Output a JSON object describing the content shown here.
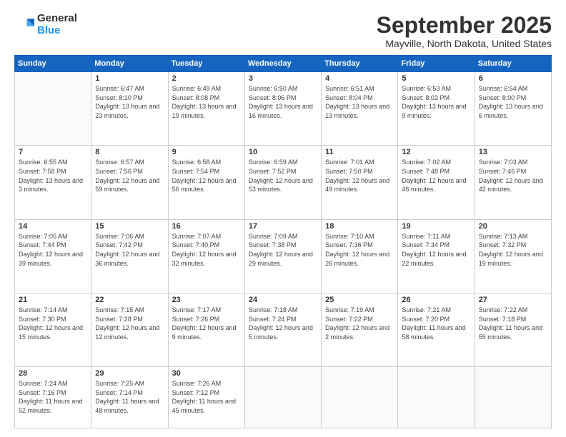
{
  "header": {
    "logo": {
      "general": "General",
      "blue": "Blue"
    },
    "title": "September 2025",
    "location": "Mayville, North Dakota, United States"
  },
  "weekdays": [
    "Sunday",
    "Monday",
    "Tuesday",
    "Wednesday",
    "Thursday",
    "Friday",
    "Saturday"
  ],
  "weeks": [
    [
      {
        "day": "",
        "sunrise": "",
        "sunset": "",
        "daylight": ""
      },
      {
        "day": "1",
        "sunrise": "Sunrise: 6:47 AM",
        "sunset": "Sunset: 8:10 PM",
        "daylight": "Daylight: 13 hours and 23 minutes."
      },
      {
        "day": "2",
        "sunrise": "Sunrise: 6:49 AM",
        "sunset": "Sunset: 8:08 PM",
        "daylight": "Daylight: 13 hours and 19 minutes."
      },
      {
        "day": "3",
        "sunrise": "Sunrise: 6:50 AM",
        "sunset": "Sunset: 8:06 PM",
        "daylight": "Daylight: 13 hours and 16 minutes."
      },
      {
        "day": "4",
        "sunrise": "Sunrise: 6:51 AM",
        "sunset": "Sunset: 8:04 PM",
        "daylight": "Daylight: 13 hours and 13 minutes."
      },
      {
        "day": "5",
        "sunrise": "Sunrise: 6:53 AM",
        "sunset": "Sunset: 8:02 PM",
        "daylight": "Daylight: 13 hours and 9 minutes."
      },
      {
        "day": "6",
        "sunrise": "Sunrise: 6:54 AM",
        "sunset": "Sunset: 8:00 PM",
        "daylight": "Daylight: 13 hours and 6 minutes."
      }
    ],
    [
      {
        "day": "7",
        "sunrise": "Sunrise: 6:55 AM",
        "sunset": "Sunset: 7:58 PM",
        "daylight": "Daylight: 13 hours and 3 minutes."
      },
      {
        "day": "8",
        "sunrise": "Sunrise: 6:57 AM",
        "sunset": "Sunset: 7:56 PM",
        "daylight": "Daylight: 12 hours and 59 minutes."
      },
      {
        "day": "9",
        "sunrise": "Sunrise: 6:58 AM",
        "sunset": "Sunset: 7:54 PM",
        "daylight": "Daylight: 12 hours and 56 minutes."
      },
      {
        "day": "10",
        "sunrise": "Sunrise: 6:59 AM",
        "sunset": "Sunset: 7:52 PM",
        "daylight": "Daylight: 12 hours and 53 minutes."
      },
      {
        "day": "11",
        "sunrise": "Sunrise: 7:01 AM",
        "sunset": "Sunset: 7:50 PM",
        "daylight": "Daylight: 12 hours and 49 minutes."
      },
      {
        "day": "12",
        "sunrise": "Sunrise: 7:02 AM",
        "sunset": "Sunset: 7:48 PM",
        "daylight": "Daylight: 12 hours and 46 minutes."
      },
      {
        "day": "13",
        "sunrise": "Sunrise: 7:03 AM",
        "sunset": "Sunset: 7:46 PM",
        "daylight": "Daylight: 12 hours and 42 minutes."
      }
    ],
    [
      {
        "day": "14",
        "sunrise": "Sunrise: 7:05 AM",
        "sunset": "Sunset: 7:44 PM",
        "daylight": "Daylight: 12 hours and 39 minutes."
      },
      {
        "day": "15",
        "sunrise": "Sunrise: 7:06 AM",
        "sunset": "Sunset: 7:42 PM",
        "daylight": "Daylight: 12 hours and 36 minutes."
      },
      {
        "day": "16",
        "sunrise": "Sunrise: 7:07 AM",
        "sunset": "Sunset: 7:40 PM",
        "daylight": "Daylight: 12 hours and 32 minutes."
      },
      {
        "day": "17",
        "sunrise": "Sunrise: 7:09 AM",
        "sunset": "Sunset: 7:38 PM",
        "daylight": "Daylight: 12 hours and 29 minutes."
      },
      {
        "day": "18",
        "sunrise": "Sunrise: 7:10 AM",
        "sunset": "Sunset: 7:36 PM",
        "daylight": "Daylight: 12 hours and 26 minutes."
      },
      {
        "day": "19",
        "sunrise": "Sunrise: 7:11 AM",
        "sunset": "Sunset: 7:34 PM",
        "daylight": "Daylight: 12 hours and 22 minutes."
      },
      {
        "day": "20",
        "sunrise": "Sunrise: 7:13 AM",
        "sunset": "Sunset: 7:32 PM",
        "daylight": "Daylight: 12 hours and 19 minutes."
      }
    ],
    [
      {
        "day": "21",
        "sunrise": "Sunrise: 7:14 AM",
        "sunset": "Sunset: 7:30 PM",
        "daylight": "Daylight: 12 hours and 15 minutes."
      },
      {
        "day": "22",
        "sunrise": "Sunrise: 7:15 AM",
        "sunset": "Sunset: 7:28 PM",
        "daylight": "Daylight: 12 hours and 12 minutes."
      },
      {
        "day": "23",
        "sunrise": "Sunrise: 7:17 AM",
        "sunset": "Sunset: 7:26 PM",
        "daylight": "Daylight: 12 hours and 9 minutes."
      },
      {
        "day": "24",
        "sunrise": "Sunrise: 7:18 AM",
        "sunset": "Sunset: 7:24 PM",
        "daylight": "Daylight: 12 hours and 5 minutes."
      },
      {
        "day": "25",
        "sunrise": "Sunrise: 7:19 AM",
        "sunset": "Sunset: 7:22 PM",
        "daylight": "Daylight: 12 hours and 2 minutes."
      },
      {
        "day": "26",
        "sunrise": "Sunrise: 7:21 AM",
        "sunset": "Sunset: 7:20 PM",
        "daylight": "Daylight: 11 hours and 58 minutes."
      },
      {
        "day": "27",
        "sunrise": "Sunrise: 7:22 AM",
        "sunset": "Sunset: 7:18 PM",
        "daylight": "Daylight: 11 hours and 55 minutes."
      }
    ],
    [
      {
        "day": "28",
        "sunrise": "Sunrise: 7:24 AM",
        "sunset": "Sunset: 7:16 PM",
        "daylight": "Daylight: 11 hours and 52 minutes."
      },
      {
        "day": "29",
        "sunrise": "Sunrise: 7:25 AM",
        "sunset": "Sunset: 7:14 PM",
        "daylight": "Daylight: 11 hours and 48 minutes."
      },
      {
        "day": "30",
        "sunrise": "Sunrise: 7:26 AM",
        "sunset": "Sunset: 7:12 PM",
        "daylight": "Daylight: 11 hours and 45 minutes."
      },
      {
        "day": "",
        "sunrise": "",
        "sunset": "",
        "daylight": ""
      },
      {
        "day": "",
        "sunrise": "",
        "sunset": "",
        "daylight": ""
      },
      {
        "day": "",
        "sunrise": "",
        "sunset": "",
        "daylight": ""
      },
      {
        "day": "",
        "sunrise": "",
        "sunset": "",
        "daylight": ""
      }
    ]
  ]
}
